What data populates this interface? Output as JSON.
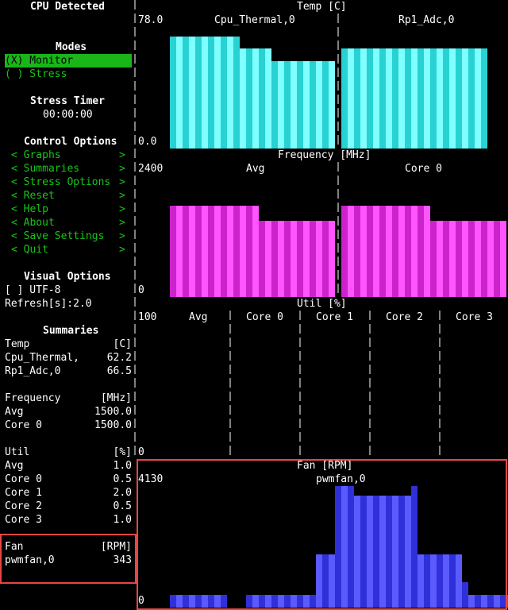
{
  "sidebar": {
    "title": "CPU Detected",
    "modes": {
      "heading": "Modes",
      "monitor": "(X) Monitor",
      "stress": "( ) Stress"
    },
    "stress_timer": {
      "heading": "Stress Timer",
      "value": "00:00:00"
    },
    "control": {
      "heading": "Control Options",
      "items": [
        "Graphs",
        "Summaries",
        "Stress Options",
        "Reset",
        "Help",
        "About",
        "Save Settings",
        "Quit"
      ]
    },
    "visual": {
      "heading": "Visual Options",
      "utf8": "[ ] UTF-8",
      "refresh": "Refresh[s]:2.0"
    },
    "summaries": {
      "heading": "Summaries",
      "temp": {
        "label": "Temp",
        "unit": "[C]",
        "rows": [
          [
            "Cpu_Thermal,",
            "62.2"
          ],
          [
            "Rp1_Adc,0",
            "66.5"
          ]
        ]
      },
      "freq": {
        "label": "Frequency",
        "unit": "[MHz]",
        "rows": [
          [
            "Avg",
            "1500.0"
          ],
          [
            "Core 0",
            "1500.0"
          ]
        ]
      },
      "util": {
        "label": "Util",
        "unit": "[%]",
        "rows": [
          [
            "Avg",
            "1.0"
          ],
          [
            "Core 0",
            "0.5"
          ],
          [
            "Core 1",
            "2.0"
          ],
          [
            "Core 2",
            "0.5"
          ],
          [
            "Core 3",
            "1.0"
          ]
        ]
      },
      "fan": {
        "label": "Fan",
        "unit": "[RPM]",
        "rows": [
          [
            "pwmfan,0",
            "343"
          ]
        ]
      }
    }
  },
  "graphs": {
    "temp": {
      "title": "Temp [C]",
      "ymax": "78.0",
      "ymin": "0.0",
      "series": [
        "Cpu_Thermal,0",
        "Rp1_Adc,0"
      ],
      "color_a": "#28d2d2",
      "color_b": "#7fffff"
    },
    "freq": {
      "title": "Frequency [MHz]",
      "ymax": "2400",
      "ymin": "0",
      "series": [
        "Avg",
        "Core 0"
      ],
      "color_a": "#cc22cc",
      "color_b": "#ff55ff"
    },
    "util": {
      "title": "Util [%]",
      "ymax": "100",
      "ymin": "0",
      "series": [
        "Avg",
        "Core 0",
        "Core 1",
        "Core 2",
        "Core 3"
      ]
    },
    "fan": {
      "title": "Fan [RPM]",
      "ymax": "4130",
      "ymin": "0",
      "series": [
        "pwmfan,0"
      ],
      "color_a": "#3030d8",
      "color_b": "#5a5aff"
    }
  },
  "chart_data": [
    {
      "type": "bar",
      "title": "Temp [C]",
      "ylim": [
        0,
        78.0
      ],
      "series": [
        {
          "name": "Cpu_Thermal,0",
          "values": [
            72,
            72,
            72,
            72,
            72,
            72,
            72,
            72,
            72,
            72,
            72,
            64,
            64,
            64,
            64,
            64,
            56,
            56,
            56,
            56,
            56,
            56,
            56,
            56,
            56,
            56
          ]
        },
        {
          "name": "Rp1_Adc,0",
          "values": [
            64,
            64,
            64,
            64,
            64,
            64,
            64,
            64,
            64,
            64,
            64,
            64,
            64,
            64,
            64,
            64,
            64,
            64,
            64,
            64,
            64,
            64,
            64
          ]
        }
      ]
    },
    {
      "type": "bar",
      "title": "Frequency [MHz]",
      "ylim": [
        0,
        2400
      ],
      "series": [
        {
          "name": "Avg",
          "values": [
            1800,
            1800,
            1800,
            1800,
            1800,
            1800,
            1800,
            1800,
            1800,
            1800,
            1800,
            1800,
            1800,
            1800,
            1500,
            1500,
            1500,
            1500,
            1500,
            1500,
            1500,
            1500,
            1500,
            1500,
            1500,
            1500
          ]
        },
        {
          "name": "Core 0",
          "values": [
            1800,
            1800,
            1800,
            1800,
            1800,
            1800,
            1800,
            1800,
            1800,
            1800,
            1800,
            1800,
            1800,
            1800,
            1500,
            1500,
            1500,
            1500,
            1500,
            1500,
            1500,
            1500,
            1500,
            1500,
            1500,
            1500
          ]
        }
      ]
    },
    {
      "type": "bar",
      "title": "Fan [RPM]",
      "ylim": [
        0,
        4130
      ],
      "series": [
        {
          "name": "pwmfan,0",
          "values": [
            430,
            430,
            430,
            430,
            430,
            430,
            430,
            430,
            430,
            0,
            0,
            0,
            430,
            430,
            430,
            430,
            430,
            430,
            430,
            430,
            430,
            430,
            430,
            1800,
            1800,
            1800,
            4130,
            4130,
            4130,
            3800,
            3800,
            3800,
            3800,
            3800,
            3800,
            3800,
            3800,
            3800,
            4130,
            1800,
            1800,
            1800,
            1800,
            1800,
            1800,
            1800,
            860,
            430,
            430,
            430,
            430,
            430,
            430,
            430,
            430,
            430,
            430
          ]
        }
      ]
    }
  ]
}
